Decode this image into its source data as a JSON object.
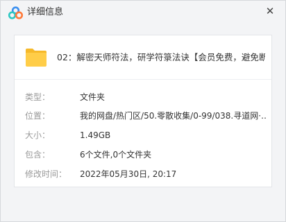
{
  "window": {
    "title": "详细信息",
    "close_glyph": "✕"
  },
  "file": {
    "name": "02：解密天师符法，研学符箓法诀【会员免费，避免断…",
    "icon": "folder-icon"
  },
  "details": [
    {
      "label": "类型：",
      "value": "文件夹"
    },
    {
      "label": "位置：",
      "value": "我的网盘/热门区/50.零散收集/0-99/038.寻道网·…"
    },
    {
      "label": "大小：",
      "value": "1.49GB"
    },
    {
      "label": "包含：",
      "value": "6个文件,0个文件夹"
    },
    {
      "label": "修改时间：",
      "value": "2022年05月30日, 20:17"
    }
  ],
  "colors": {
    "logo_blue": "#3b8ff0",
    "logo_teal": "#2cc7c2",
    "logo_orange": "#ff7a3a",
    "folder_yellow": "#ffcd48",
    "folder_dark": "#f6b92a"
  }
}
